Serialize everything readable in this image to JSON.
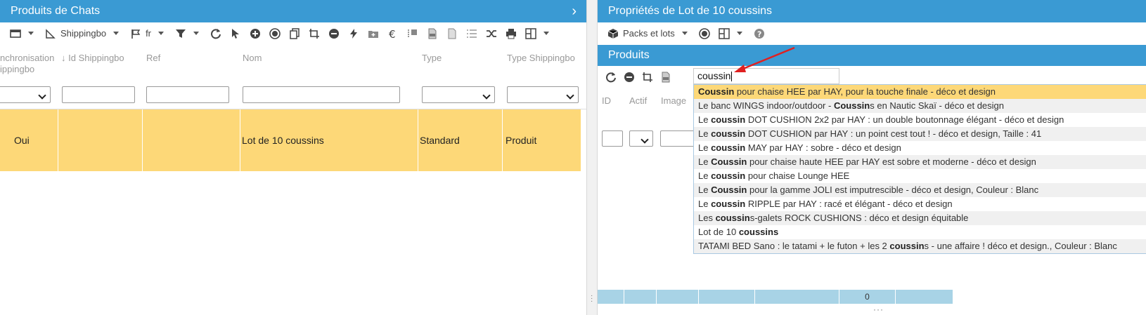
{
  "left": {
    "title": "Produits de Chats",
    "toolbar": {
      "shipping_label": "Shippingbo",
      "lang_label": "fr"
    },
    "columns": [
      "nchronisation\nippingbo",
      "Id Shippingbo",
      "Ref",
      "Nom",
      "Type",
      "Type Shippingbo"
    ],
    "row": {
      "sync": "Oui",
      "id_shippingbo": "",
      "ref": "",
      "nom": "Lot de 10 coussins",
      "type": "Standard",
      "type_shippingbo": "Produit"
    }
  },
  "right": {
    "title": "Propriétés de Lot de 10 coussins",
    "toolbar": {
      "packs_label": "Packs et lots"
    },
    "subpanel_title": "Produits",
    "search_value": "coussin",
    "columns": [
      "ID",
      "Actif",
      "Image"
    ],
    "suggestions": [
      {
        "pre": "",
        "hl": "Coussin",
        "post": " pour chaise HEE par HAY, pour la touche finale - déco et design",
        "active": true
      },
      {
        "pre": "Le banc WINGS indoor/outdoor - ",
        "hl": "Coussin",
        "post": "s en Nautic Skaï - déco et design"
      },
      {
        "pre": "Le ",
        "hl": "coussin",
        "post": " DOT CUSHION 2x2 par HAY : un double boutonnage élégant - déco et design"
      },
      {
        "pre": "Le ",
        "hl": "coussin",
        "post": " DOT CUSHION par HAY : un point cest tout ! - déco et design, Taille : 41"
      },
      {
        "pre": "Le ",
        "hl": "coussin",
        "post": " MAY par HAY : sobre - déco et design"
      },
      {
        "pre": "Le ",
        "hl": "Coussin",
        "post": " pour chaise haute HEE par HAY est sobre et moderne - déco et design"
      },
      {
        "pre": "Le ",
        "hl": "coussin",
        "post": " pour chaise Lounge HEE"
      },
      {
        "pre": "Le ",
        "hl": "Coussin",
        "post": " pour la gamme JOLI est imputrescible - déco et design, Couleur : Blanc"
      },
      {
        "pre": "Le ",
        "hl": "coussin",
        "post": " RIPPLE par HAY : racé et élégant - déco et design"
      },
      {
        "pre": "Les ",
        "hl": "coussin",
        "post": "s-galets ROCK CUSHIONS : déco et design équitable"
      },
      {
        "pre": "Lot de 10 ",
        "hl": "coussins",
        "post": ""
      },
      {
        "pre": "TATAMI BED Sano : le tatami + le futon + les 2 ",
        "hl": "coussin",
        "post": "s - une affaire ! déco et design., Couleur : Blanc"
      }
    ],
    "footer_count": "0"
  },
  "colors": {
    "header_blue": "#3a9ad3",
    "row_highlight": "#fdd878",
    "footer_blue": "#a8d3e6",
    "arrow_red": "#e02020"
  }
}
